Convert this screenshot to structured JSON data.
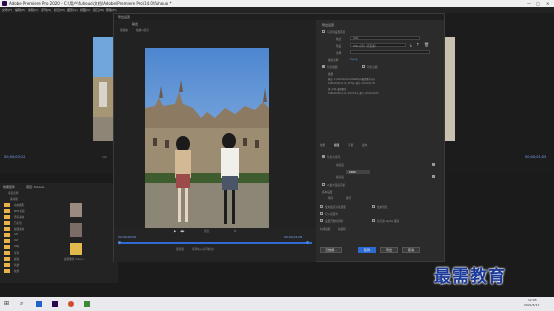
{
  "app": {
    "title": "Adobe Premiere Pro 2020 - C:\\用户\\fuhouo\\文档\\Adobe\\Premiere Pro\\14.0\\fuhouo *",
    "menu": [
      "文件(F)",
      "编辑(E)",
      "剪辑(C)",
      "序列(S)",
      "标记(M)",
      "图形(G)",
      "视图(V)",
      "窗口(W)",
      "帮助(H)"
    ],
    "window_controls": [
      "—",
      "□",
      "✕"
    ]
  },
  "left_monitor": {
    "timecode": "00;00;03;12",
    "page": "1/2"
  },
  "right_monitor": {
    "timecode": "00;00;01;05"
  },
  "project_panel": {
    "tabs": [
      "效果控件",
      "项目: fuhouo"
    ],
    "items": [
      "项目名称",
      "素材箱",
      "动态图形",
      "MP4音频",
      "所有素材",
      "已标签",
      "视频素材",
      "ATI",
      "AVI",
      "RWJ",
      "序列",
      "视频",
      "新建",
      "效果"
    ],
    "thumb_label": "最需教育 fuhou..."
  },
  "dialog": {
    "title": "导出设置",
    "tabs": [
      "输出"
    ],
    "source_scaling_label": "源缩放",
    "source_scaling_value": "缩放以适合",
    "export_settings": {
      "header": "导出设置",
      "match_sequence": "与序列设置匹配",
      "format_label": "格式",
      "format_value": "PNG",
      "preset_label": "预设",
      "preset_value": "PNG 序列（匹配源）",
      "comment_label": "注释",
      "output_name_label": "输出名称",
      "output_name_value": "0.png",
      "export_video": "导出视频",
      "export_audio": "导出音频",
      "summary_label": "摘要",
      "summary_output": "输出: C:\\Users\\fuhouo\\Desktop\\最需教育.jpg",
      "summary_output_detail": "1080x1920 (1.0), 25 fps, 逐行, 00;00;01;05",
      "summary_source": "源: 序列, 最需教育",
      "summary_source_detail": "1080x1920 (1.0), 29.97 fps, 逐行, 00;00;01;05"
    },
    "setting_tabs": [
      "效果",
      "视频",
      "字幕",
      "发布"
    ],
    "export_as_sequence": "导出为序列",
    "frame_width_label": "帧宽度",
    "frame_height_label": "帧高度",
    "frame_value": "1080",
    "render_max_depth": "以最大深度渲染",
    "basic_settings_label": "基本设置",
    "field_order_label": "场序",
    "field_order_value": "逐行",
    "options": [
      "使用最高渲染质量",
      "使用预览",
      "导入项目中",
      "设置开始时间码",
      "仅渲染 Alpha 通道"
    ],
    "time_interpolation_label": "时间插值",
    "time_interpolation_value": "帧采样",
    "buttons": {
      "metadata": "元数据...",
      "queue": "队列",
      "export": "导出",
      "cancel": "取消"
    },
    "timeline": {
      "in_timecode": "00;00;00;00",
      "out_timecode": "00;00;01;05",
      "source_range_label": "源范围",
      "source_range_value": "序列切入/序列切出",
      "fit_label": "适合"
    }
  },
  "taskbar": {
    "time": "12:05",
    "date": "2021/5/17"
  },
  "watermark": "最需教育"
}
